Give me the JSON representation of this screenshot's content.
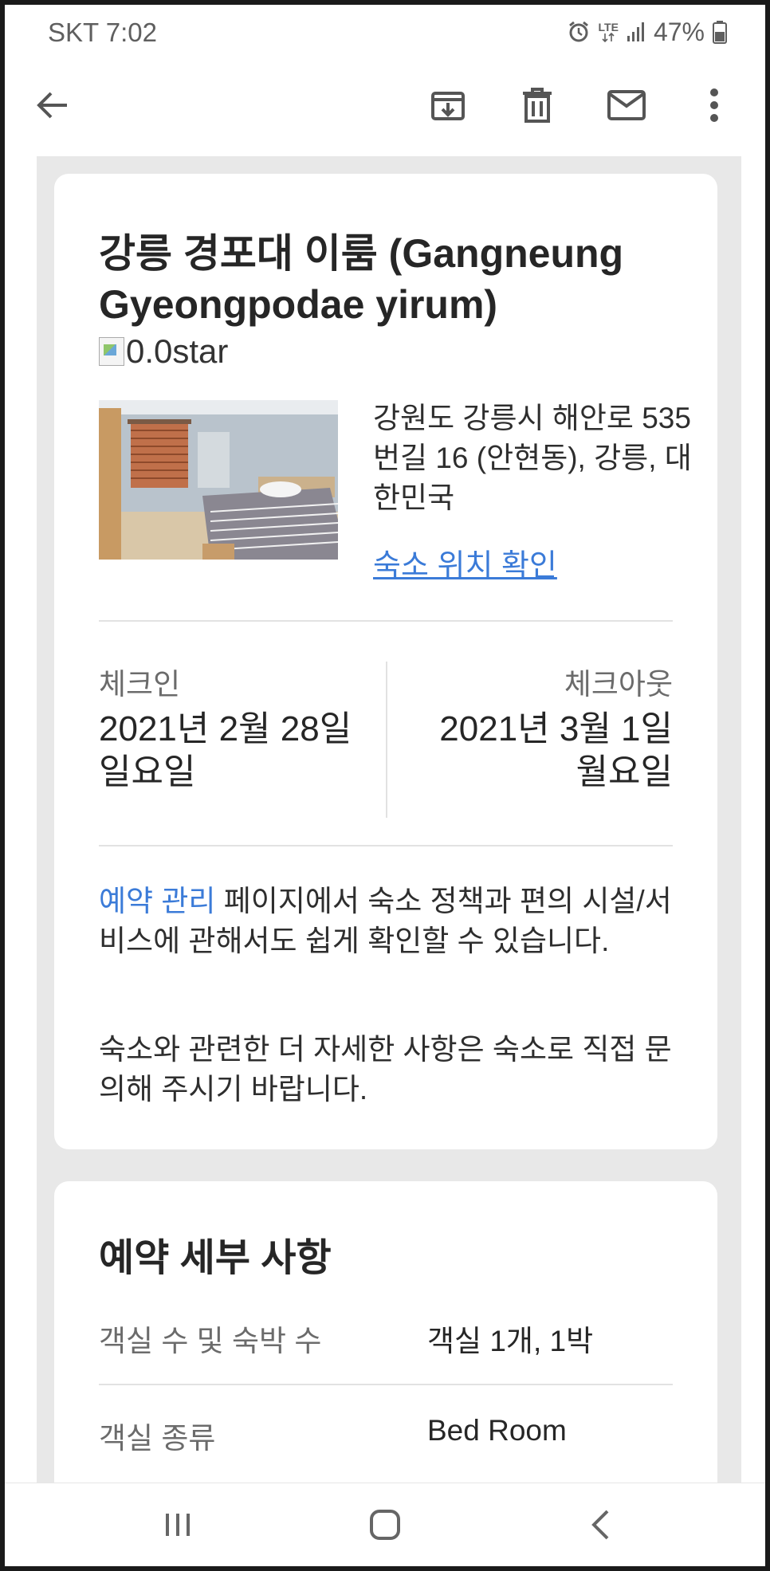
{
  "status_bar": {
    "carrier_time": "SKT 7:02",
    "network": "LTE",
    "battery": "47%",
    "icons": [
      "alarm-icon",
      "lte-icon",
      "signal-icon",
      "battery-icon"
    ]
  },
  "app_bar": {
    "icons": [
      "back-arrow-icon",
      "archive-icon",
      "delete-icon",
      "mail-icon",
      "more-vert-icon"
    ]
  },
  "hotel": {
    "title": "강릉 경포대 이룸 (Gangneung Gyeongpodae yirum)",
    "star_alt": "0.0star",
    "address": "강원도 강릉시 해안로 535번길 16 (안현동), 강릉, 대한민국",
    "map_link": "숙소 위치 확인"
  },
  "stay": {
    "checkin_label": "체크인",
    "checkin_date": "2021년 2월 28일 일요일",
    "checkout_label": "체크아웃",
    "checkout_date": "2021년 3월 1일 월요일"
  },
  "policy": {
    "link_text": "예약 관리",
    "text": " 페이지에서 숙소 정책과 편의 시설/서비스에 관해서도 쉽게 확인할 수 있습니다.",
    "contact_text": "숙소와 관련한 더 자세한 사항은 숙소로 직접 문의해 주시기 바랍니다."
  },
  "details": {
    "title": "예약 세부 사항",
    "rows": [
      {
        "label": "객실 수 및 숙박 수",
        "value": "객실 1개, 1박"
      },
      {
        "label": "객실 종류",
        "value": "Bed Room"
      }
    ]
  },
  "nav_bar": {
    "icons": [
      "recent-apps-icon",
      "home-icon",
      "back-icon"
    ]
  },
  "colors": {
    "accent_link": "#3b7bd8",
    "background_strip": "#e8e8e8",
    "text_primary": "#262626",
    "text_secondary": "#6b6b6b"
  }
}
